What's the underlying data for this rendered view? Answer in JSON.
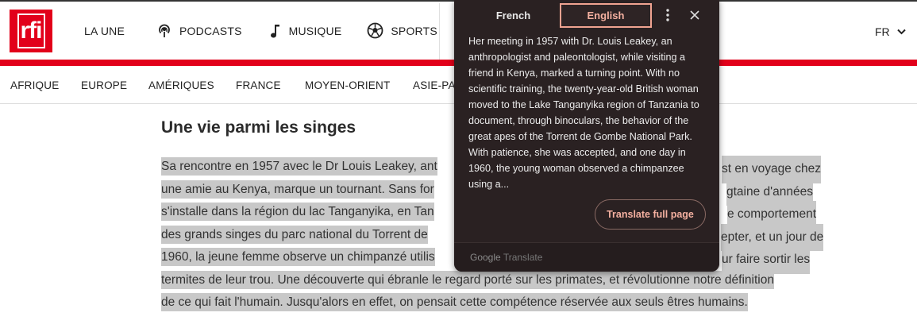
{
  "header": {
    "logo_text": "rfi",
    "nav": [
      {
        "label": "LA UNE",
        "icon": "none"
      },
      {
        "label": "PODCASTS",
        "icon": "podcast-icon"
      },
      {
        "label": "MUSIQUE",
        "icon": "music-note-icon"
      },
      {
        "label": "SPORTS",
        "icon": "soccer-ball-icon"
      }
    ],
    "language": "FR"
  },
  "sections": [
    "AFRIQUE",
    "EUROPE",
    "AMÉRIQUES",
    "FRANCE",
    "MOYEN-ORIENT",
    "ASIE-PAC"
  ],
  "article": {
    "title": "Une vie parmi les singes",
    "paragraph_lines": [
      "Sa rencontre en 1957 avec le Dr Louis Leakey, ant",
      "st en voyage chez",
      "une amie au Kenya, marque un tournant. Sans for",
      "gtaine d'années",
      "s'installe dans la région du lac Tanganyika, en Tan",
      "e comportement",
      "des grands singes du parc national du Torrent de",
      "epter, et un jour de",
      "1960, la jeune femme observe un chimpanzé utilis",
      "ur faire sortir les",
      "termites de leur trou. Une découverte qui ébranle le regard porté sur les primates, et révolutionne notre définition",
      "de ce qui fait l'humain. Jusqu'alors en effet, on pensait cette compétence réservée aux seuls êtres humains."
    ]
  },
  "translate_popup": {
    "source_tab": "French",
    "target_tab": "English",
    "translation": "Her meeting in 1957 with Dr. Louis Leakey, an anthropologist and paleontologist, while visiting a friend in Kenya, marked a turning point. With no scientific training, the twenty-year-old British woman moved to the Lake Tanganyika region of Tanzania to document, through binoculars, the behavior of the great apes of the Torrent de Gombe National Park. With patience, she was accepted, and one day in 1960, the young woman observed a chimpanzee using a...",
    "full_page_button": "Translate full page",
    "footer_brand": "Google",
    "footer_product": "Translate"
  },
  "colors": {
    "brand_red": "#e2001a",
    "popup_bg": "#2a2122",
    "accent": "#f4b0a0",
    "highlight": "#c8c8c8"
  }
}
